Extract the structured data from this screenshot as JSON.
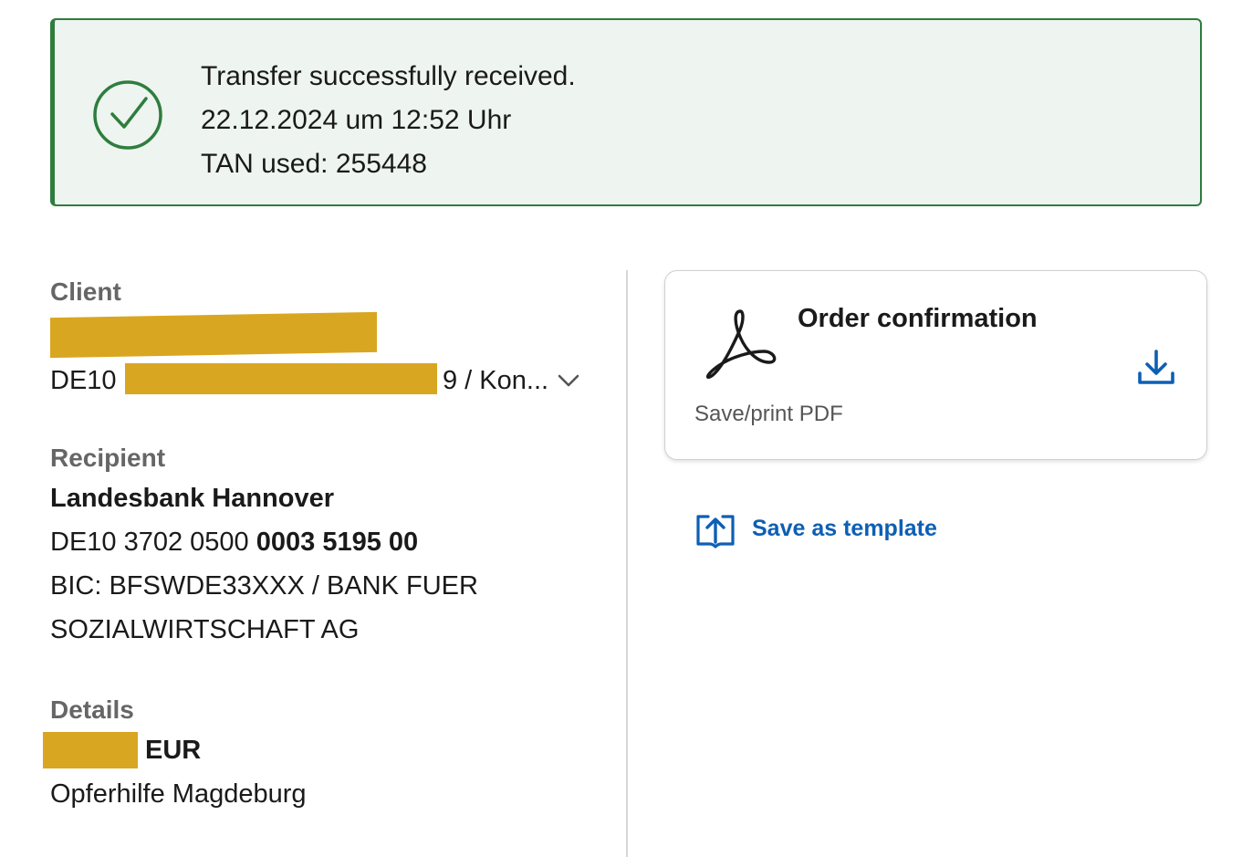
{
  "banner": {
    "icon": "checkmark-circle-icon",
    "status": "Transfer successfully received.",
    "datetime": "22.12.2024 um 12:52 Uhr",
    "tan": "TAN used: 255448",
    "colors": {
      "accent": "#2e7d3e",
      "background": "#eef4ef"
    }
  },
  "client": {
    "label": "Client",
    "iban_prefix": "DE10",
    "iban_suffix": "9 / Kon...",
    "dropdown_icon": "chevron-down-icon"
  },
  "recipient": {
    "label": "Recipient",
    "name": "Landesbank Hannover",
    "iban_start": "DE10 3702 0500",
    "iban_end": "0003 5195 00",
    "bic_line1": "BIC: BFSWDE33XXX / BANK FUER",
    "bic_line2": "SOZIALWIRTSCHAFT AG"
  },
  "details": {
    "label": "Details",
    "currency": "EUR",
    "reference": "Opferhilfe Magdeburg"
  },
  "order_confirmation": {
    "icon": "pdf-icon",
    "title": "Order confirmation",
    "subtitle": "Save/print PDF",
    "action_icon": "download-icon"
  },
  "save_template": {
    "icon": "book-upload-icon",
    "label": "Save as template",
    "color": "#0d5fb5"
  },
  "redaction_color": "#d9a621"
}
